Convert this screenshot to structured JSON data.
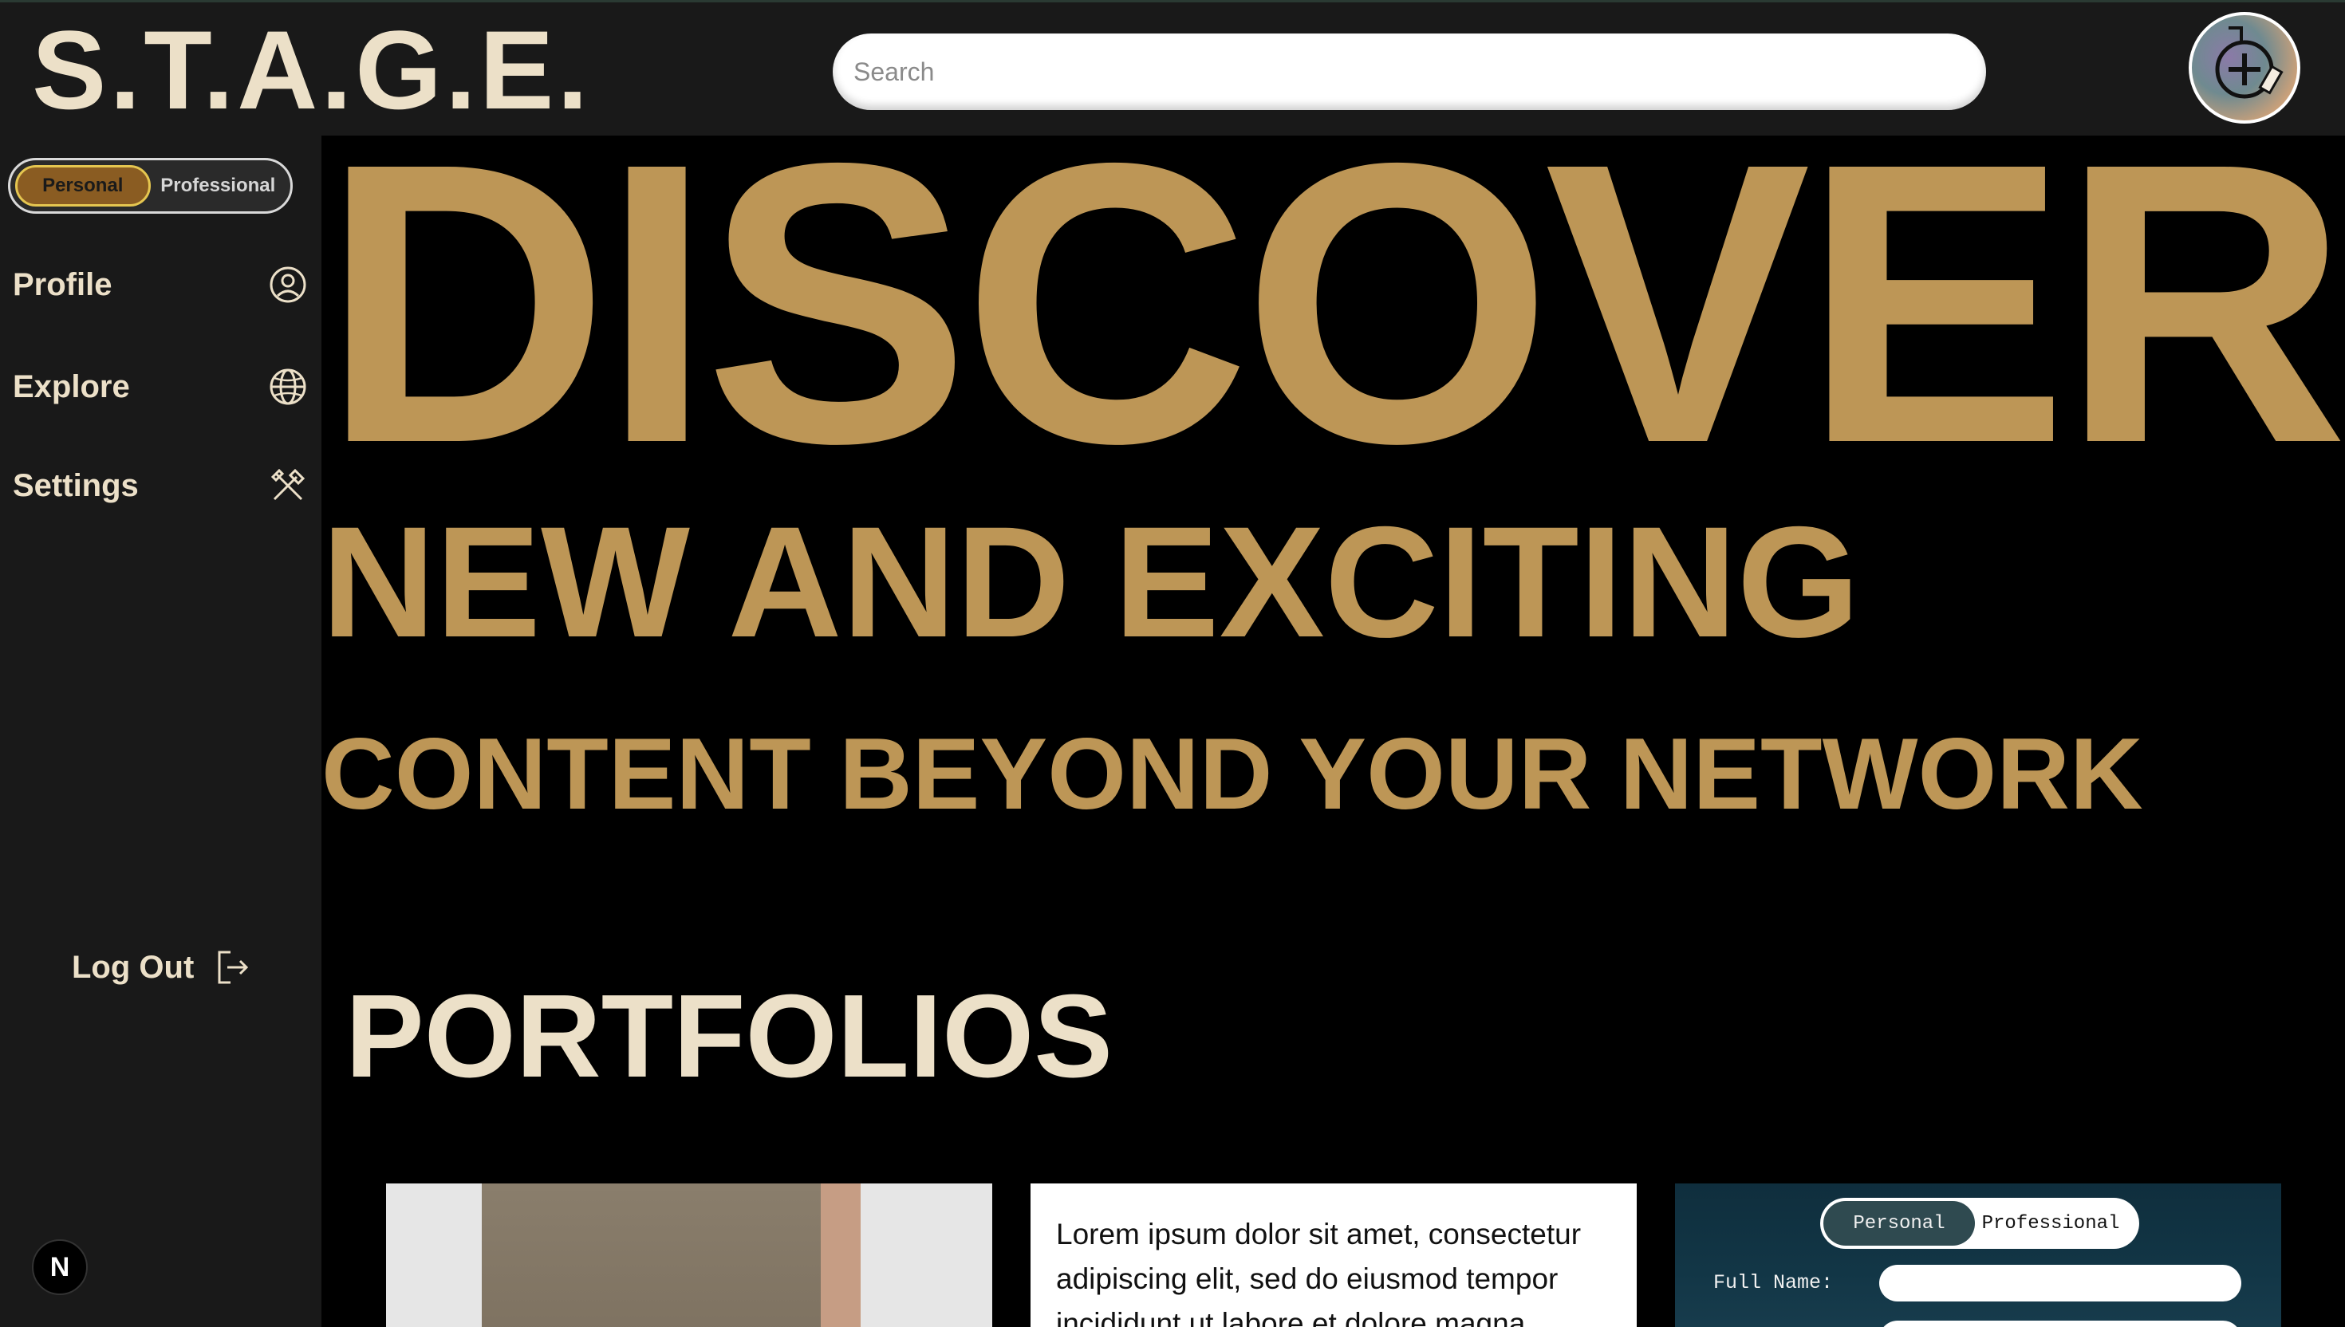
{
  "header": {
    "logo": "S.T.A.G.E.",
    "search_placeholder": "Search",
    "create_icon": "plus-paintbrush-icon"
  },
  "sidebar": {
    "toggle": {
      "personal": "Personal",
      "professional": "Professional",
      "active": "Personal"
    },
    "items": [
      {
        "label": "Profile",
        "icon": "user-circle-icon"
      },
      {
        "label": "Explore",
        "icon": "globe-icon"
      },
      {
        "label": "Settings",
        "icon": "tools-icon"
      }
    ],
    "logout": {
      "label": "Log Out",
      "icon": "logout-icon"
    },
    "badge": "N"
  },
  "hero": {
    "line1": "DISCOVER",
    "line2": "NEW AND EXCITING",
    "line3": "CONTENT BEYOND YOUR NETWORK"
  },
  "portfolios": {
    "heading": "PORTFOLIOS",
    "cards": [
      {
        "type": "image"
      },
      {
        "type": "text",
        "text": "Lorem ipsum dolor sit amet, consectetur adipiscing elit, sed do eiusmod tempor incididunt ut labore et dolore magna"
      },
      {
        "type": "form",
        "toggle_personal": "Personal",
        "toggle_professional": "Professional",
        "field_label": "Full Name:"
      }
    ]
  },
  "colors": {
    "gold": "#bd9656",
    "cream": "#ece0c8",
    "panel": "#191919"
  }
}
